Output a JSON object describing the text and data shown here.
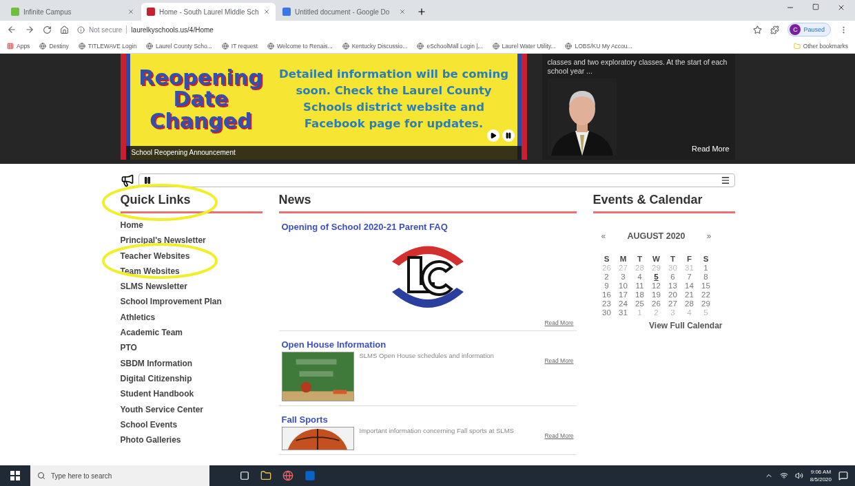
{
  "browser": {
    "tabs": [
      {
        "label": "Infinite Campus",
        "selected": false
      },
      {
        "label": "Home - South Laurel Middle Sch",
        "selected": true
      },
      {
        "label": "Untitled document - Google Do",
        "selected": false
      }
    ],
    "security": "Not secure",
    "url": "laurelkyschools.us/4/Home",
    "profile": {
      "initial": "C",
      "status": "Paused"
    },
    "bookmarks": [
      "Apps",
      "Destiny",
      "TITLEWAVE Login",
      "Laurel County Scho...",
      "IT request",
      "Welcome to Renais...",
      "Kentucky Discussio...",
      "eSchoolMall Login |...",
      "Laurel Water Utility...",
      "LOBS/KU My Accou..."
    ],
    "other_bookmarks": "Other bookmarks"
  },
  "hero": {
    "sign_title": "Reopening Date Changed",
    "sign_text": "Detailed information will be coming soon.  Check the Laurel County Schools district website and Facebook page for updates.",
    "caption": "School Reopening Announcement",
    "feature": {
      "text": "classes and two exploratory classes. At the start of each school year ...",
      "link": "Read More"
    }
  },
  "quick_links": {
    "title": "Quick Links",
    "items": [
      "Home",
      "Principal's Newsletter",
      "Teacher Websites",
      "Team Websites",
      "SLMS Newsletter",
      "School Improvement Plan",
      "Athletics",
      "Academic Team",
      "PTO",
      "SBDM Information",
      "Digital Citizenship",
      "Student Handbook",
      "Youth Service Center",
      "School Events",
      "Photo Galleries"
    ]
  },
  "news": {
    "title": "News",
    "items": [
      {
        "title": "Opening of School 2020-21 Parent FAQ",
        "kind": "logo",
        "link": "Read More"
      },
      {
        "title": "Open House Information",
        "kind": "chalkboard",
        "text": "SLMS Open House schedules and information",
        "link": "Read More"
      },
      {
        "title": "Fall Sports",
        "kind": "ball",
        "text": "Important information concerning Fall sports at SLMS",
        "link": "Read More"
      }
    ]
  },
  "calendar": {
    "title": "Events & Calendar",
    "prev": "«",
    "month": "AUGUST 2020",
    "next": "»",
    "weekdays": [
      "S",
      "M",
      "T",
      "W",
      "T",
      "F",
      "S"
    ],
    "days": [
      {
        "d": "26",
        "outside": true,
        "today": false
      },
      {
        "d": "27",
        "outside": true,
        "today": false
      },
      {
        "d": "28",
        "outside": true,
        "today": false
      },
      {
        "d": "29",
        "outside": true,
        "today": false
      },
      {
        "d": "30",
        "outside": true,
        "today": false
      },
      {
        "d": "31",
        "outside": true,
        "today": false
      },
      {
        "d": "1",
        "outside": false,
        "today": false
      },
      {
        "d": "2",
        "outside": false,
        "today": false
      },
      {
        "d": "3",
        "outside": false,
        "today": false
      },
      {
        "d": "4",
        "outside": false,
        "today": false
      },
      {
        "d": "5",
        "outside": false,
        "today": true
      },
      {
        "d": "6",
        "outside": false,
        "today": false
      },
      {
        "d": "7",
        "outside": false,
        "today": false
      },
      {
        "d": "8",
        "outside": false,
        "today": false
      },
      {
        "d": "9",
        "outside": false,
        "today": false
      },
      {
        "d": "10",
        "outside": false,
        "today": false
      },
      {
        "d": "11",
        "outside": false,
        "today": false
      },
      {
        "d": "12",
        "outside": false,
        "today": false
      },
      {
        "d": "13",
        "outside": false,
        "today": false
      },
      {
        "d": "14",
        "outside": false,
        "today": false
      },
      {
        "d": "15",
        "outside": false,
        "today": false
      },
      {
        "d": "16",
        "outside": false,
        "today": false
      },
      {
        "d": "17",
        "outside": false,
        "today": false
      },
      {
        "d": "18",
        "outside": false,
        "today": false
      },
      {
        "d": "19",
        "outside": false,
        "today": false
      },
      {
        "d": "20",
        "outside": false,
        "today": false
      },
      {
        "d": "21",
        "outside": false,
        "today": false
      },
      {
        "d": "22",
        "outside": false,
        "today": false
      },
      {
        "d": "23",
        "outside": false,
        "today": false
      },
      {
        "d": "24",
        "outside": false,
        "today": false
      },
      {
        "d": "25",
        "outside": false,
        "today": false
      },
      {
        "d": "26",
        "outside": false,
        "today": false
      },
      {
        "d": "27",
        "outside": false,
        "today": false
      },
      {
        "d": "28",
        "outside": false,
        "today": false
      },
      {
        "d": "29",
        "outside": false,
        "today": false
      },
      {
        "d": "30",
        "outside": false,
        "today": false
      },
      {
        "d": "31",
        "outside": false,
        "today": false
      },
      {
        "d": "1",
        "outside": true,
        "today": false
      },
      {
        "d": "2",
        "outside": true,
        "today": false
      },
      {
        "d": "3",
        "outside": true,
        "today": false
      },
      {
        "d": "4",
        "outside": true,
        "today": false
      },
      {
        "d": "5",
        "outside": true,
        "today": false
      }
    ],
    "link": "View Full Calendar"
  },
  "taskbar": {
    "search_placeholder": "Type here to search",
    "time": "9:06 AM",
    "date": "8/5/2020"
  }
}
